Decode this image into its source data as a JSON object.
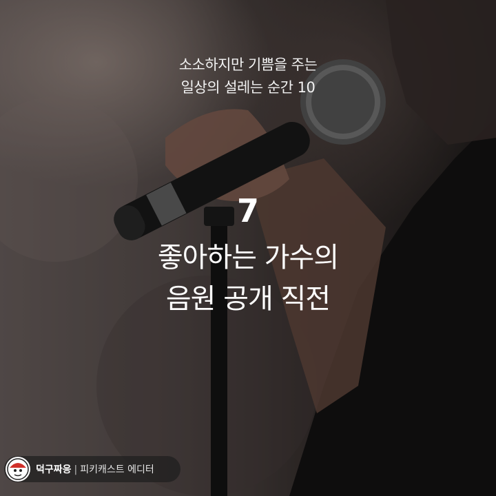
{
  "series_title": {
    "line1": "소소하지만 기쁨을 주는",
    "line2": "일상의 설레는 순간 10"
  },
  "item": {
    "number": "7",
    "title_line1": "좋아하는 가수의",
    "title_line2": "음원 공개 직전"
  },
  "credit": {
    "name": "덕구짜응",
    "separator": "|",
    "role": "피키캐스트 에디터",
    "avatar_icon": "cartoon-avatar-icon"
  },
  "colors": {
    "text": "#ffffff",
    "credit_pill": "#1e1e1e",
    "avatar_accent": "#d0302a"
  }
}
